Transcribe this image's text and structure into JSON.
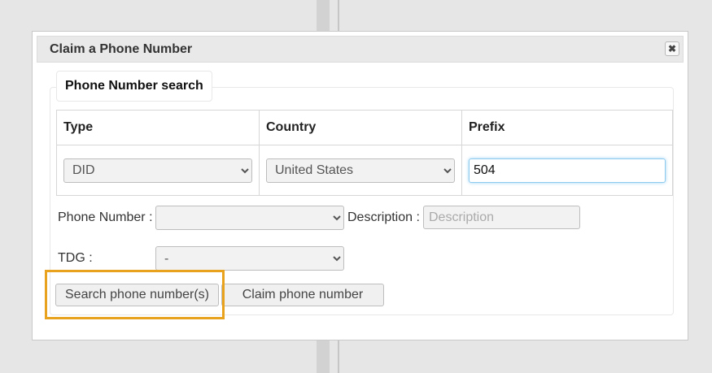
{
  "dialog": {
    "title": "Claim a Phone Number",
    "close_symbol": "✖"
  },
  "search": {
    "legend": "Phone Number search",
    "columns": [
      "Type",
      "Country",
      "Prefix"
    ],
    "type_value": "DID",
    "country_value": "United States",
    "prefix_value": "504"
  },
  "form": {
    "phone_number_label": "Phone Number :",
    "phone_number_value": "",
    "description_label": "Description :",
    "description_placeholder": "Description",
    "tdg_label": "TDG :",
    "tdg_value": "-"
  },
  "buttons": {
    "search_label": "Search phone number(s)",
    "claim_label": "Claim phone number"
  },
  "colors": {
    "highlight": "#e9a21d",
    "focus_border": "#8ccaf0"
  }
}
